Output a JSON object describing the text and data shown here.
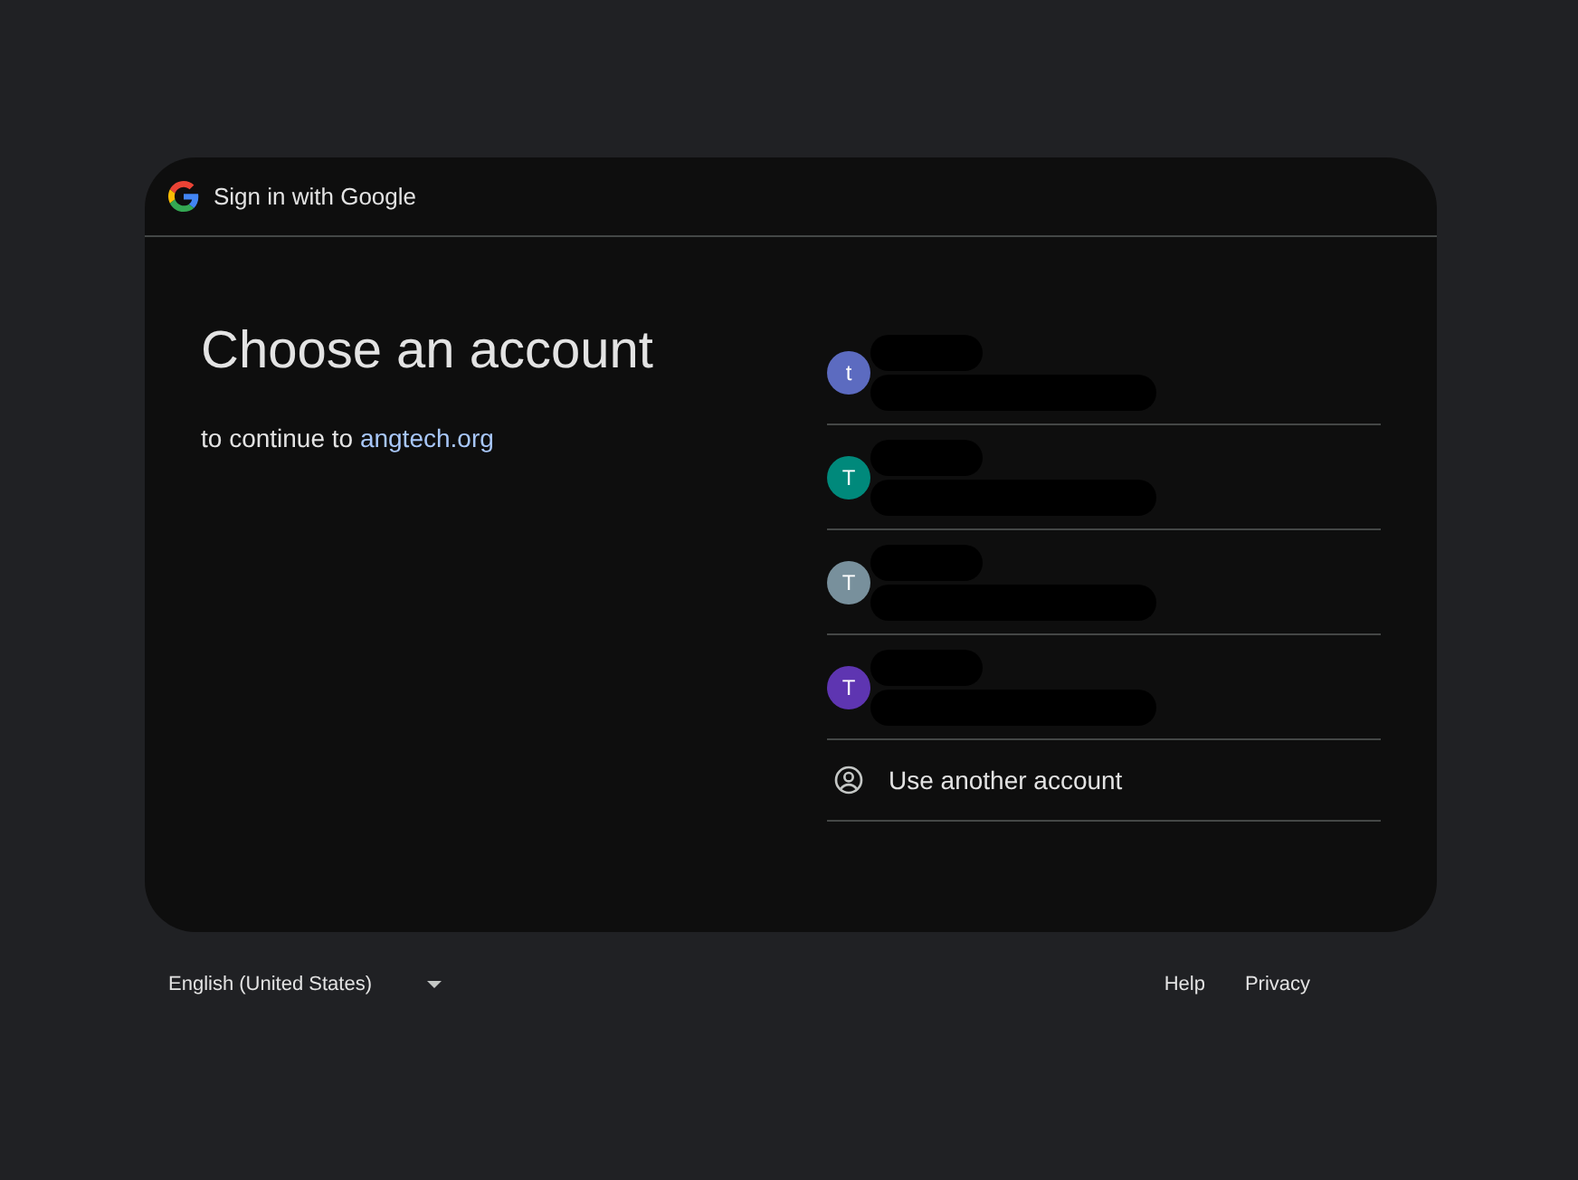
{
  "header": {
    "title": "Sign in with Google"
  },
  "heading": {
    "title": "Choose an account",
    "subtitle": "to continue to",
    "site": "angtech.org"
  },
  "accounts": [
    {
      "avatar_letter": "t",
      "color": "#5c6bc0",
      "redacted": true
    },
    {
      "avatar_letter": "T",
      "color": "#00897b",
      "redacted": true
    },
    {
      "avatar_letter": "T",
      "color": "#78909c",
      "redacted": true
    },
    {
      "avatar_letter": "T",
      "color": "#5e35b1",
      "redacted": true
    }
  ],
  "other_account": {
    "label": "Use another account"
  },
  "footer": {
    "language": "English (United States)",
    "links": [
      "Help",
      "Privacy"
    ]
  }
}
